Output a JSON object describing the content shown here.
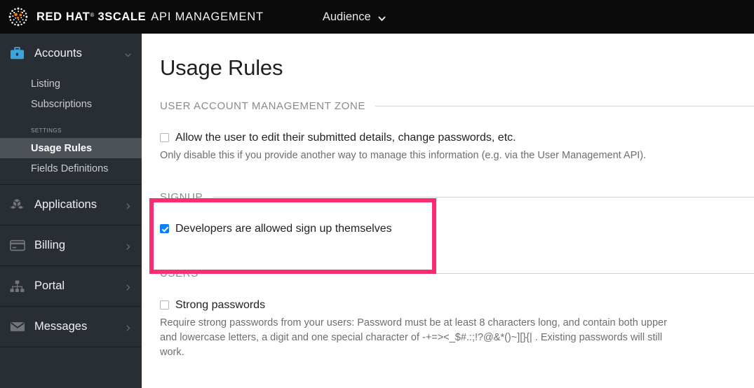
{
  "topbar": {
    "logo_icon": "redhat-logo-icon",
    "brand_strong": "RED HAT",
    "brand_tm": "®",
    "brand_product": "3SCALE",
    "brand_regular": "API MANAGEMENT",
    "audience_label": "Audience",
    "audience_chevron_icon": "chevron-down-icon",
    "background": "#0b0b0b"
  },
  "sidebar": {
    "background": "#292e34",
    "active_background": "#4d5258",
    "groups": [
      {
        "label": "Accounts",
        "icon": "briefcase-icon",
        "icon_color": "#39a5dc",
        "arrow_icon": "chevron-down-icon",
        "expanded": true,
        "items": [
          {
            "label": "Listing",
            "active": false
          },
          {
            "label": "Subscriptions",
            "active": false
          }
        ],
        "subheading": "Settings",
        "settings_items": [
          {
            "label": "Usage Rules",
            "active": true
          },
          {
            "label": "Fields Definitions",
            "active": false
          }
        ]
      },
      {
        "label": "Applications",
        "icon": "cubes-icon",
        "icon_color": "#72767b",
        "arrow_icon": "chevron-right-icon",
        "expanded": false
      },
      {
        "label": "Billing",
        "icon": "credit-card-icon",
        "icon_color": "#72767b",
        "arrow_icon": "chevron-right-icon",
        "expanded": false
      },
      {
        "label": "Portal",
        "icon": "sitemap-icon",
        "icon_color": "#72767b",
        "arrow_icon": "chevron-right-icon",
        "expanded": false
      },
      {
        "label": "Messages",
        "icon": "envelope-icon",
        "icon_color": "#72767b",
        "arrow_icon": "chevron-right-icon",
        "expanded": false
      }
    ]
  },
  "main": {
    "page_title": "Usage Rules",
    "sections": [
      {
        "heading": "USER ACCOUNT MANAGEMENT ZONE",
        "checkbox_label": "Allow the user to edit their submitted details, change passwords, etc.",
        "checked": false,
        "helptext": "Only disable this if you provide another way to manage this information (e.g. via the User Management API)."
      },
      {
        "heading": "SIGNUP",
        "checkbox_label": "Developers are allowed sign up themselves",
        "checked": true,
        "helptext": ""
      },
      {
        "heading": "USERS",
        "checkbox_label": "Strong passwords",
        "checked": false,
        "helptext": "Require strong passwords from your users: Password must be at least 8 characters long, and contain both upper and lowercase letters, a digit and one special character of -+=><_$#.:;!?@&*()~][}{| . Existing passwords will still work."
      }
    ]
  },
  "highlight": {
    "name": "signup-section-highlight",
    "color": "#fa2d6e"
  }
}
